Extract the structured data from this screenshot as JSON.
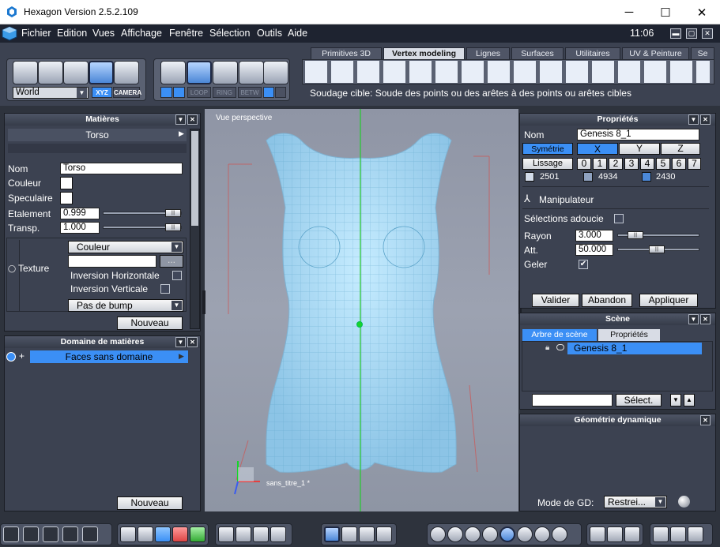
{
  "window": {
    "title": "Hexagon Version 2.5.2.109",
    "minimize": "─",
    "maximize": "☐",
    "close": "✕"
  },
  "menu": {
    "items": [
      "Fichier",
      "Edition",
      "Vues",
      "Affichage",
      "Fenêtre",
      "Sélection",
      "Outils",
      "Aide"
    ],
    "clock": "11:06"
  },
  "toolbar": {
    "coord_select": "World",
    "xyz": "XYZ",
    "camera": "CAMERA",
    "mode_labels": [
      "LOOP",
      "RING",
      "BETW"
    ],
    "tabs": [
      "Primitives 3D",
      "Vertex modeling",
      "Lignes",
      "Surfaces",
      "Utilitaires",
      "UV & Peinture",
      "Se"
    ],
    "active_tab": "Vertex modeling",
    "hint": "Soudage cible: Soude des points ou des arêtes à des points ou arêtes cibles"
  },
  "materials": {
    "title": "Matières",
    "current": "Torso",
    "name_label": "Nom",
    "name_value": "Torso",
    "color_label": "Couleur",
    "specular_label": "Speculaire",
    "spread_label": "Etalement",
    "spread_value": "0.999",
    "transp_label": "Transp.",
    "transp_value": "1.000",
    "texture_label": "Texture",
    "texture_type": "Couleur",
    "inv_h": "Inversion Horizontale",
    "inv_v": "Inversion Verticale",
    "bump": "Pas de bump",
    "new_button": "Nouveau"
  },
  "domains": {
    "title": "Domaine de matières",
    "item": "Faces sans domaine",
    "new_button": "Nouveau"
  },
  "viewport": {
    "label": "Vue perspective",
    "file_label": "sans_titre_1 *"
  },
  "properties": {
    "title": "Propriétés",
    "name_label": "Nom",
    "name_value": "Genesis 8_1",
    "symmetry_label": "Symétrie",
    "axes": [
      "X",
      "Y",
      "Z"
    ],
    "smooth_label": "Lissage",
    "levels": [
      "0",
      "1",
      "2",
      "3",
      "4",
      "5",
      "6",
      "7"
    ],
    "counts": [
      "2501",
      "4934",
      "2430"
    ],
    "manipulator": "Manipulateur",
    "soft_sel": "Sélections adoucie",
    "radius_label": "Rayon",
    "radius_value": "3.000",
    "att_label": "Att.",
    "att_value": "50.000",
    "freeze_label": "Geler",
    "validate": "Valider",
    "cancel": "Abandon",
    "apply": "Appliquer"
  },
  "scene": {
    "title": "Scène",
    "tabs": [
      "Arbre de scène",
      "Propriétés"
    ],
    "item": "Genesis 8_1",
    "select_button": "Sélect."
  },
  "dyngeo": {
    "title": "Géométrie dynamique",
    "mode_label": "Mode de GD:",
    "mode_value": "Restrei..."
  },
  "colors": {
    "accent": "#3b8ff5",
    "panel": "#3c4251",
    "dark": "#2e333d",
    "mesh": "#a8dcf6"
  }
}
